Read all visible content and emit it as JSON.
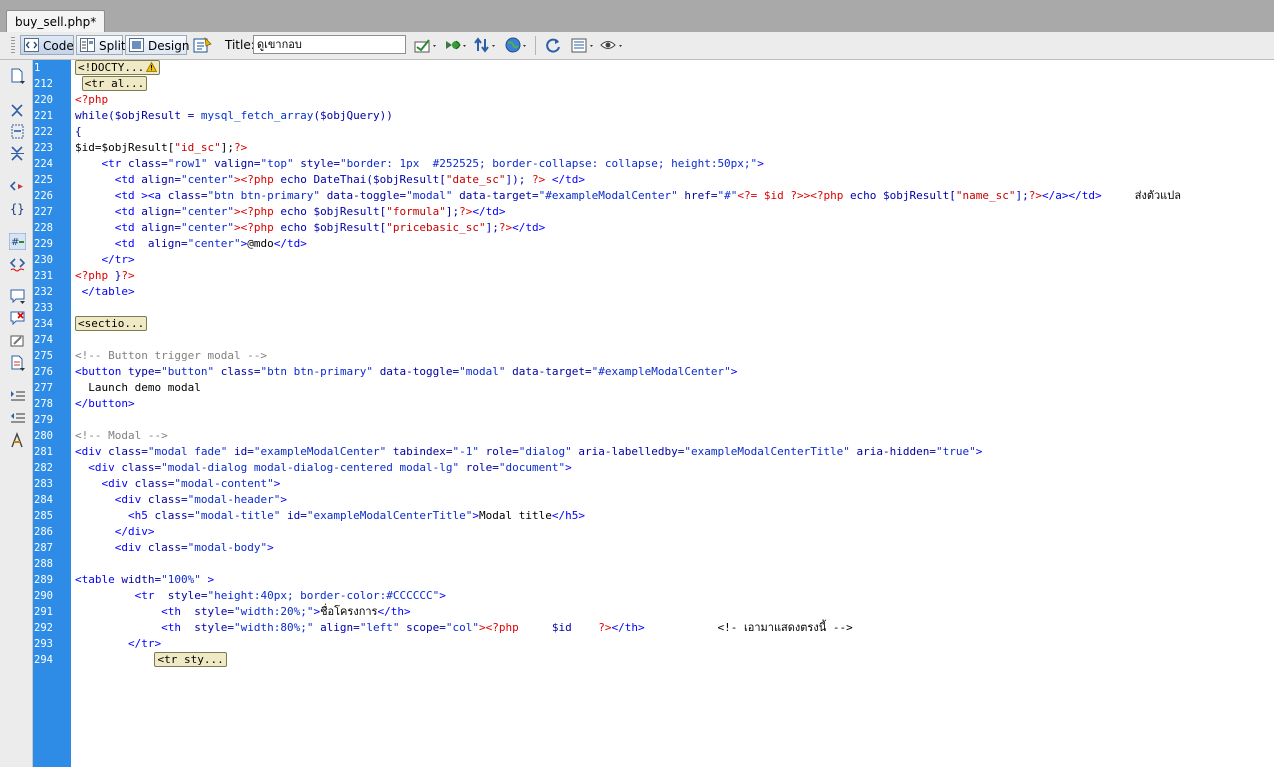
{
  "document": {
    "tab_label": "buy_sell.php*"
  },
  "toolbar": {
    "code_label": "Code",
    "split_label": "Split",
    "design_label": "Design",
    "title_label": "Title:",
    "title_value": "ดูเขากอบ"
  },
  "gutter": {
    "line_numbers": [
      "1",
      "212",
      "220",
      "221",
      "222",
      "223",
      "224",
      "225",
      "226",
      "227",
      "228",
      "229",
      "230",
      "231",
      "232",
      "233",
      "234",
      "274",
      "275",
      "276",
      "277",
      "278",
      "279",
      "280",
      "281",
      "282",
      "283",
      "284",
      "285",
      "286",
      "287",
      "288",
      "289",
      "290",
      "291",
      "292",
      "293",
      "294"
    ]
  },
  "code": {
    "l1": "<!DOCTY...",
    "l212": "<tr al...",
    "l220": "<?php",
    "l221_a": "while($objResult = ",
    "l221_b": "mysql_fetch_array",
    "l221_c": "($objQuery))",
    "l222": "{",
    "l223_a": "$id=$objResult[",
    "l223_b": "\"id_sc\"",
    "l223_c": "];",
    "l223_d": "?>",
    "l224_a": "    <tr ",
    "l224_b": "class=",
    "l224_c": "\"row1\" ",
    "l224_d": "valign=",
    "l224_e": "\"top\" ",
    "l224_f": "style=",
    "l224_g": "\"border: 1px  #252525; border-collapse: collapse; height:50px;\"",
    "l224_h": ">",
    "l225_a": "      <td ",
    "l225_b": "align=",
    "l225_c": "\"center\"",
    "l225_d": "><?php ",
    "l225_e": "echo DateThai($objResult[",
    "l225_f": "\"date_sc\"",
    "l225_g": "]); ",
    "l225_h": "?>",
    "l225_i": " </td>",
    "l226_a": "      <td ><a ",
    "l226_b": "class=",
    "l226_c": "\"btn btn-primary\" ",
    "l226_d": "data-toggle=",
    "l226_e": "\"modal\" ",
    "l226_f": "data-target=",
    "l226_g": "\"#exampleModalCenter\" ",
    "l226_h": "href=",
    "l226_i": "\"#\"",
    "l226_j": "<?= $id ?>",
    "l226_k": "><?php ",
    "l226_l": "echo $objResult[",
    "l226_m": "\"name_sc\"",
    "l226_n": "];",
    "l226_o": "?>",
    "l226_p": "</a></td>",
    "l226_q": "     ส่งตัวแปล",
    "l227_a": "      <td ",
    "l227_b": "align=",
    "l227_c": "\"center\"",
    "l227_d": "><?php ",
    "l227_e": "echo $objResult[",
    "l227_f": "\"formula\"",
    "l227_g": "];",
    "l227_h": "?>",
    "l227_i": "</td>",
    "l228_a": "      <td ",
    "l228_b": "align=",
    "l228_c": "\"center\"",
    "l228_d": "><?php ",
    "l228_e": "echo $objResult[",
    "l228_f": "\"pricebasic_sc\"",
    "l228_g": "];",
    "l228_h": "?>",
    "l228_i": "</td>",
    "l229_a": "      <td  ",
    "l229_b": "align=",
    "l229_c": "\"center\"",
    "l229_d": ">",
    "l229_e": "@mdo",
    "l229_f": "</td>",
    "l230": "    </tr>",
    "l231_a": "<?php ",
    "l231_b": "}",
    "l231_c": "?>",
    "l232": " </table>",
    "l234": "<sectio...",
    "l275": "<!-- Button trigger modal -->",
    "l276_a": "<button ",
    "l276_b": "type=",
    "l276_c": "\"button\" ",
    "l276_d": "class=",
    "l276_e": "\"btn btn-primary\" ",
    "l276_f": "data-toggle=",
    "l276_g": "\"modal\" ",
    "l276_h": "data-target=",
    "l276_i": "\"#exampleModalCenter\"",
    "l276_j": ">",
    "l277": "  Launch demo modal",
    "l278": "</button>",
    "l280": "<!-- Modal -->",
    "l281_a": "<div ",
    "l281_b": "class=",
    "l281_c": "\"modal fade\" ",
    "l281_d": "id=",
    "l281_e": "\"exampleModalCenter\" ",
    "l281_f": "tabindex=",
    "l281_g": "\"-1\" ",
    "l281_h": "role=",
    "l281_i": "\"dialog\" ",
    "l281_j": "aria-labelledby=",
    "l281_k": "\"exampleModalCenterTitle\" ",
    "l281_l": "aria-hidden=",
    "l281_m": "\"true\"",
    "l281_n": ">",
    "l282_a": "  <div ",
    "l282_b": "class=",
    "l282_c": "\"modal-dialog modal-dialog-centered modal-lg\" ",
    "l282_d": "role=",
    "l282_e": "\"document\"",
    "l282_f": ">",
    "l283_a": "    <div ",
    "l283_b": "class=",
    "l283_c": "\"modal-content\"",
    "l283_d": ">",
    "l284_a": "      <div ",
    "l284_b": "class=",
    "l284_c": "\"modal-header\"",
    "l284_d": ">",
    "l285_a": "        <h5 ",
    "l285_b": "class=",
    "l285_c": "\"modal-title\" ",
    "l285_d": "id=",
    "l285_e": "\"exampleModalCenterTitle\"",
    "l285_f": ">",
    "l285_g": "Modal title",
    "l285_h": "</h5>",
    "l286": "      </div>",
    "l287_a": "      <div ",
    "l287_b": "class=",
    "l287_c": "\"modal-body\"",
    "l287_d": ">",
    "l289_a": "<table ",
    "l289_b": "width=",
    "l289_c": "\"100%\" ",
    "l289_d": ">",
    "l290_a": "         <tr  ",
    "l290_b": "style=",
    "l290_c": "\"height:40px; border-color:#CCCCCC\"",
    "l290_d": ">",
    "l291_a": "             <th  ",
    "l291_b": "style=",
    "l291_c": "\"width:20%;\"",
    "l291_d": ">",
    "l291_e": "ชื่อโครงการ",
    "l291_f": "</th>",
    "l292_a": "             <th  ",
    "l292_b": "style=",
    "l292_c": "\"width:80%;\" ",
    "l292_d": "align=",
    "l292_e": "\"left\" ",
    "l292_f": "scope=",
    "l292_g": "\"col\"",
    "l292_h": "><?php",
    "l292_i": "     $id    ",
    "l292_j": "?>",
    "l292_k": "</th>",
    "l292_l": "           <!- เอามาแสดงตรงนี้ -->",
    "l293": "        </tr>",
    "l294": "<tr sty..."
  },
  "colors": {
    "gutter": "#2e8ce6",
    "tag": "#0000ff",
    "php": "#e00000",
    "comment": "#808080"
  }
}
